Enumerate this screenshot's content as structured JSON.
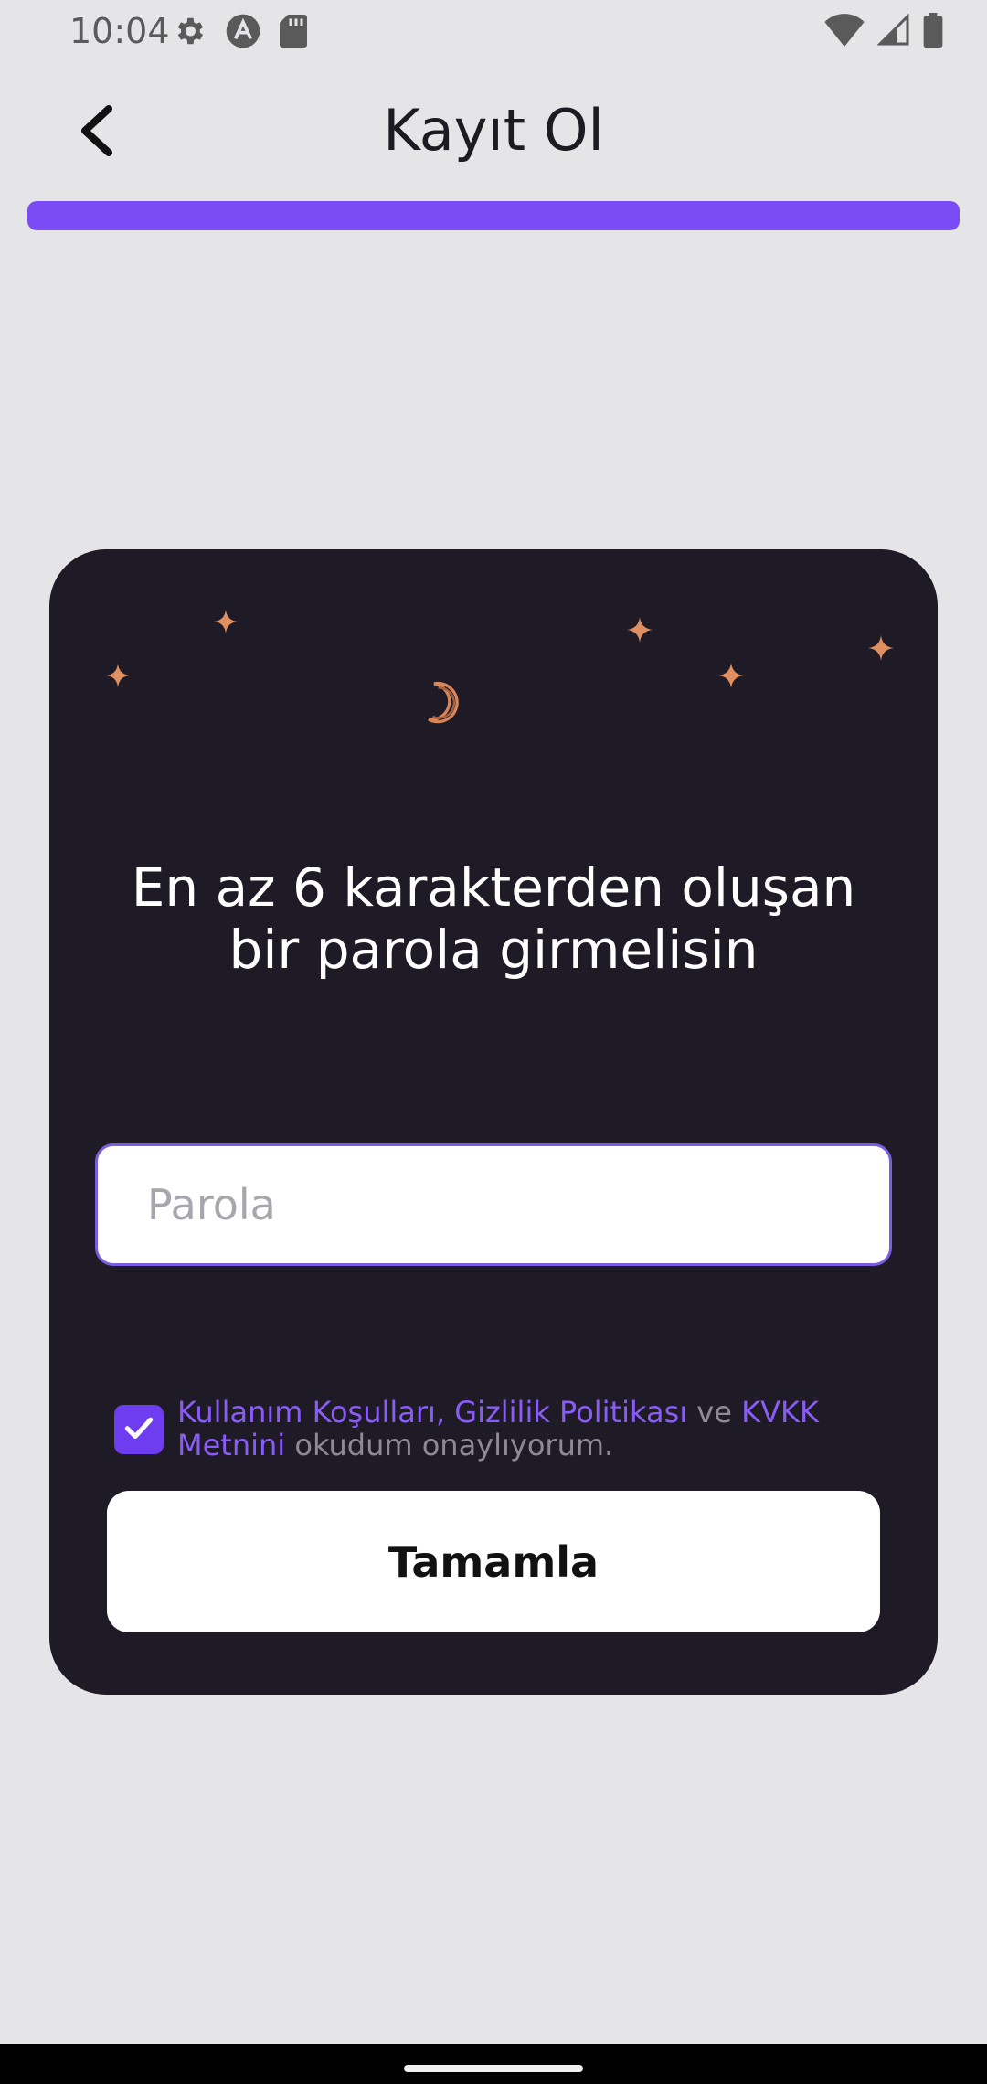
{
  "status_bar": {
    "time": "10:04",
    "left_icons": [
      "gear-icon",
      "a-circle-icon",
      "sd-card-icon"
    ],
    "right_icons": [
      "wifi-icon",
      "signal-icon",
      "battery-icon"
    ]
  },
  "header": {
    "title": "Kayıt Ol",
    "back_icon": "chevron-left-icon"
  },
  "progress": {
    "fraction": 1.0,
    "color": "#7b4cf5"
  },
  "card": {
    "background": "#1e1a26",
    "decorations": [
      "sparkle-icon",
      "moon-icon"
    ],
    "heading_line1": "En az 6 karakterden oluşan",
    "heading_line2": "bir parola girmelisin",
    "password": {
      "value": "",
      "placeholder": "Parola"
    },
    "terms": {
      "checked": true,
      "link1": "Kullanım Koşulları, Gizlilik Politikası",
      "connector": " ve ",
      "link2": "KVKK Metnini",
      "suffix": " okudum onaylıyorum."
    },
    "complete_button": "Tamamla"
  },
  "colors": {
    "accent": "#7b4cf5",
    "link": "#8a5cf6",
    "sparkle": "#e09060"
  }
}
